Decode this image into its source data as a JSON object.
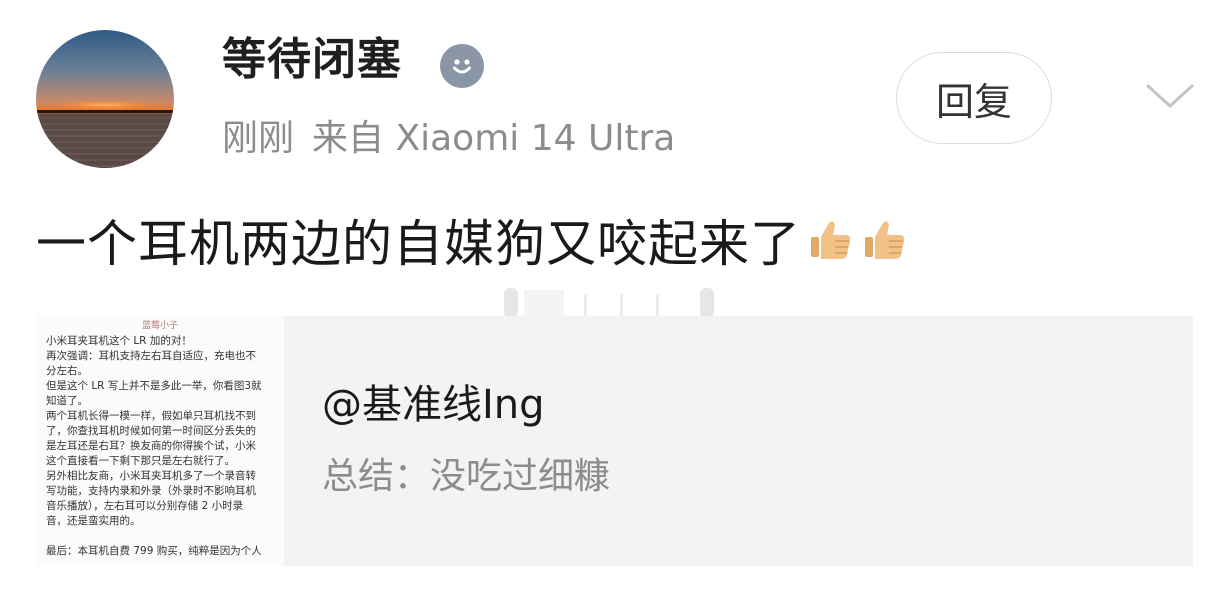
{
  "header": {
    "username": "等待闭塞",
    "time": "刚刚",
    "source": "来自 Xiaomi 14 Ultra",
    "reply_label": "回复"
  },
  "post": {
    "text": "一个耳机两边的自媒狗又咬起来了"
  },
  "card": {
    "title": "@基准线Ing",
    "subtitle": "总结：没吃过细糠",
    "thumbnail": {
      "header": "蓝莓小子",
      "lines": [
        "小米耳夹耳机这个 LR 加的对！",
        "再次强调：耳机支持左右耳自适应，充电也不",
        "分左右。",
        "但是这个 LR 写上并不是多此一举，你看图3就",
        "知道了。",
        "两个耳机长得一模一样，假如单只耳机找不到",
        "了，你查找耳机时候如何第一时间区分丢失的",
        "是左耳还是右耳？换友商的你得挨个试，小米",
        "这个直接看一下剩下那只是左右就行了。",
        "另外相比友商，小米耳夹耳机多了一个录音转",
        "写功能，支持内录和外录（外录时不影响耳机",
        "音乐播放），左右耳可以分别存储 2 小时录",
        "音，还是蛮实用的。",
        "",
        "最后：本耳机自费 799 购买，纯粹是因为个人"
      ]
    }
  },
  "icons": {
    "verified": "smiley-badge-icon",
    "expand": "chevron-down-icon",
    "thumbs": "thumbs-up-icon"
  },
  "colors": {
    "meta_gray": "#8c8c8c",
    "card_bg": "#f3f3f3",
    "badge": "#8a95a6"
  }
}
